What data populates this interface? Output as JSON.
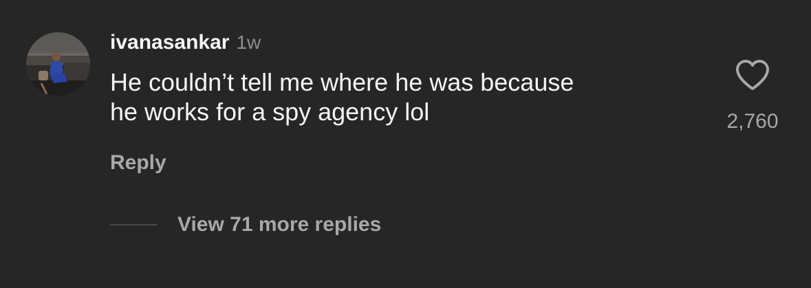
{
  "comment": {
    "username": "ivanasankar",
    "time": "1w",
    "text": "He couldn’t tell me where he was because\nhe works for a spy agency lol",
    "reply_label": "Reply",
    "like_count": "2,760",
    "like_icon": "heart-outline-icon",
    "view_replies_label": "View 71 more replies"
  }
}
